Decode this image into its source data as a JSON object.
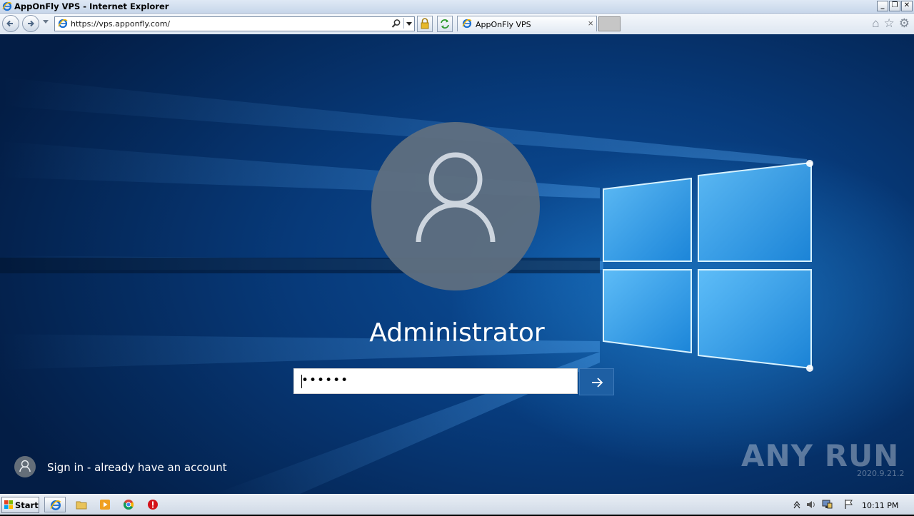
{
  "browser": {
    "window_title": "AppOnFly VPS - Internet Explorer",
    "url": "https://vps.apponfly.com/",
    "tab_title": "AppOnFly VPS",
    "tab_close": "×"
  },
  "login": {
    "username": "Administrator",
    "password_mask": "••••••",
    "other_user_label": "Sign in - already have an account"
  },
  "watermark": {
    "text": "ANY RUN",
    "version": "2020.9.21.2"
  },
  "taskbar": {
    "start_label": "Start",
    "clock": "10:11 PM"
  },
  "colors": {
    "accent": "#1e5fa3",
    "desktop_blue": "#073a7a"
  }
}
